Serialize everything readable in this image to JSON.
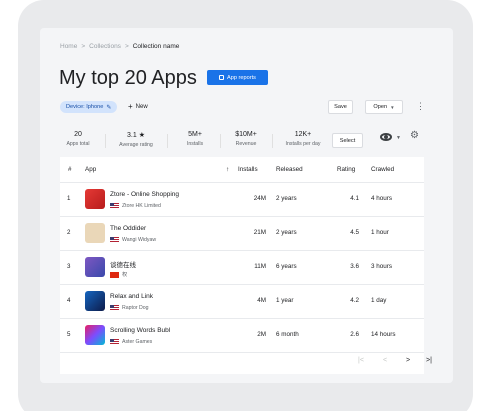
{
  "breadcrumb": [
    "Home",
    "Collections",
    "Collection name"
  ],
  "page_title": "My top 20 Apps",
  "app_reports_label": "App reports",
  "device_chip": "Device: Iphone",
  "new_label": "New",
  "save_label": "Save",
  "open_label": "Open",
  "select_label": "Select",
  "stats": [
    {
      "value": "20",
      "label": "Apps total"
    },
    {
      "value": "3.1 ★",
      "label": "Average rating"
    },
    {
      "value": "5M+",
      "label": "Installs"
    },
    {
      "value": "$10M+",
      "label": "Revenue"
    },
    {
      "value": "12K+",
      "label": "Installs per day"
    }
  ],
  "columns": {
    "num": "#",
    "app": "App",
    "installs": "Installs",
    "released": "Released",
    "rating": "Rating",
    "crawled": "Crawled"
  },
  "rows": [
    {
      "num": "1",
      "name": "Ztore - Online Shopping",
      "developer": "Ztore HK Limited",
      "installs": "24M",
      "released": "2 years",
      "rating": "4.1",
      "crawled": "4 hours"
    },
    {
      "num": "2",
      "name": "The Oddider",
      "developer": "Wangi Widyaw",
      "installs": "21M",
      "released": "2 years",
      "rating": "4.5",
      "crawled": "1 hour"
    },
    {
      "num": "3",
      "name": "谈德在线",
      "developer": "权",
      "installs": "11M",
      "released": "6 years",
      "rating": "3.6",
      "crawled": "3 hours"
    },
    {
      "num": "4",
      "name": "Relax and Link",
      "developer": "Raptor Dog",
      "installs": "4M",
      "released": "1 year",
      "rating": "4.2",
      "crawled": "1 day"
    },
    {
      "num": "5",
      "name": "Scrolling Words Bubl",
      "developer": "Aster Games",
      "installs": "2M",
      "released": "6 month",
      "rating": "2.6",
      "crawled": "14 hours"
    }
  ],
  "pager": {
    "first": "|<",
    "prev": "<",
    "next": ">",
    "last": ">|"
  },
  "colors": {
    "accent": "#1a73e8",
    "chip_bg": "#d2e3fc"
  }
}
